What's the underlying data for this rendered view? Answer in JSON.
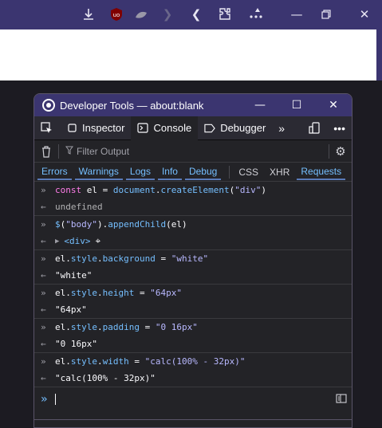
{
  "browser": {
    "toolbar_icons": [
      "download-icon",
      "ublock-icon",
      "extension-icon",
      "forward-icon",
      "back-icon",
      "puzzle-icon",
      "more-icon"
    ],
    "window_controls": [
      "minimize",
      "restore",
      "close"
    ]
  },
  "devtools": {
    "window_title": "Developer Tools — about:blank",
    "tabs": [
      {
        "label": "Inspector",
        "icon": "inspector-icon"
      },
      {
        "label": "Console",
        "icon": "console-icon"
      },
      {
        "label": "Debugger",
        "icon": "debugger-icon"
      }
    ],
    "filter_placeholder": "Filter Output",
    "categories": [
      "Errors",
      "Warnings",
      "Logs",
      "Info",
      "Debug"
    ],
    "net_categories": [
      "CSS",
      "XHR",
      "Requests"
    ],
    "entries": [
      {
        "input": "const el = document.createElement(\"div\")",
        "output": "undefined"
      },
      {
        "input": "$(\"body\").appendChild(el)",
        "output": "<div>"
      },
      {
        "input": "el.style.background = \"white\"",
        "output": "\"white\""
      },
      {
        "input": "el.style.height = \"64px\"",
        "output": "\"64px\""
      },
      {
        "input": "el.style.padding = \"0 16px\"",
        "output": "\"0 16px\""
      },
      {
        "input": "el.style.width = \"calc(100% - 32px)\"",
        "output": "\"calc(100% - 32px)\""
      }
    ]
  }
}
